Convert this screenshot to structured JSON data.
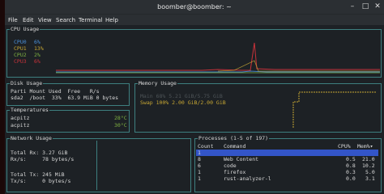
{
  "window": {
    "title": "boomber@boomber: ~"
  },
  "menubar": [
    "File",
    "Edit",
    "View",
    "Search",
    "Terminal",
    "Help"
  ],
  "cpu_usage": {
    "title": "CPU Usage",
    "legend": [
      {
        "label": "CPU0",
        "pct": "6%",
        "color": "#4a90d9"
      },
      {
        "label": "CPU1",
        "pct": "13%",
        "color": "#c7a733"
      },
      {
        "label": "CPU2",
        "pct": "2%",
        "color": "#7fb241"
      },
      {
        "label": "CPU3",
        "pct": "6%",
        "color": "#c8323a"
      }
    ]
  },
  "disk_usage": {
    "title": "Disk Usage",
    "header": "Parti Mount Used  Free   R/s",
    "row": "sda2  /boot  33%  63.9 MiB 0 bytes"
  },
  "temperatures": {
    "title": "Temperatures",
    "rows": [
      {
        "name": "acpitz",
        "value": "28°C"
      },
      {
        "name": "acpitz",
        "value": "30°C"
      }
    ]
  },
  "memory_usage": {
    "title": "Memory Usage",
    "main": "Main 68% 5.21 GiB/5.75 GiB",
    "swap": "Swap 100% 2.00 GiB/2.00 GiB"
  },
  "network_usage": {
    "title": "Network Usage",
    "total_rx": "Total Rx: 3.27 GiB",
    "rx_rate": "Rx/s:     78 bytes/s",
    "total_tx": "Total Tx: 245 MiB",
    "tx_rate": "Tx/s:     0 bytes/s"
  },
  "processes": {
    "title": "Processes (1-5 of 197)",
    "headers": {
      "count": "Count",
      "command": "Command",
      "cpu": "CPU%",
      "mem": "Mem%▾"
    },
    "rows": [
      {
        "count": "1",
        "command": "",
        "cpu": "",
        "mem": "",
        "selected": true
      },
      {
        "count": "8",
        "command": "Web Content",
        "cpu": "0.5",
        "mem": "21.0"
      },
      {
        "count": "6",
        "command": "code",
        "cpu": "0.8",
        "mem": "10.2"
      },
      {
        "count": "1",
        "command": "firefox",
        "cpu": "0.3",
        "mem": "5.0"
      },
      {
        "count": "1",
        "command": "rust-analyzer-l",
        "cpu": "0.0",
        "mem": "3.1"
      }
    ]
  },
  "colors": {
    "border": "#3e7f80",
    "selection": "#3355c8",
    "swap": "#c7a733"
  }
}
